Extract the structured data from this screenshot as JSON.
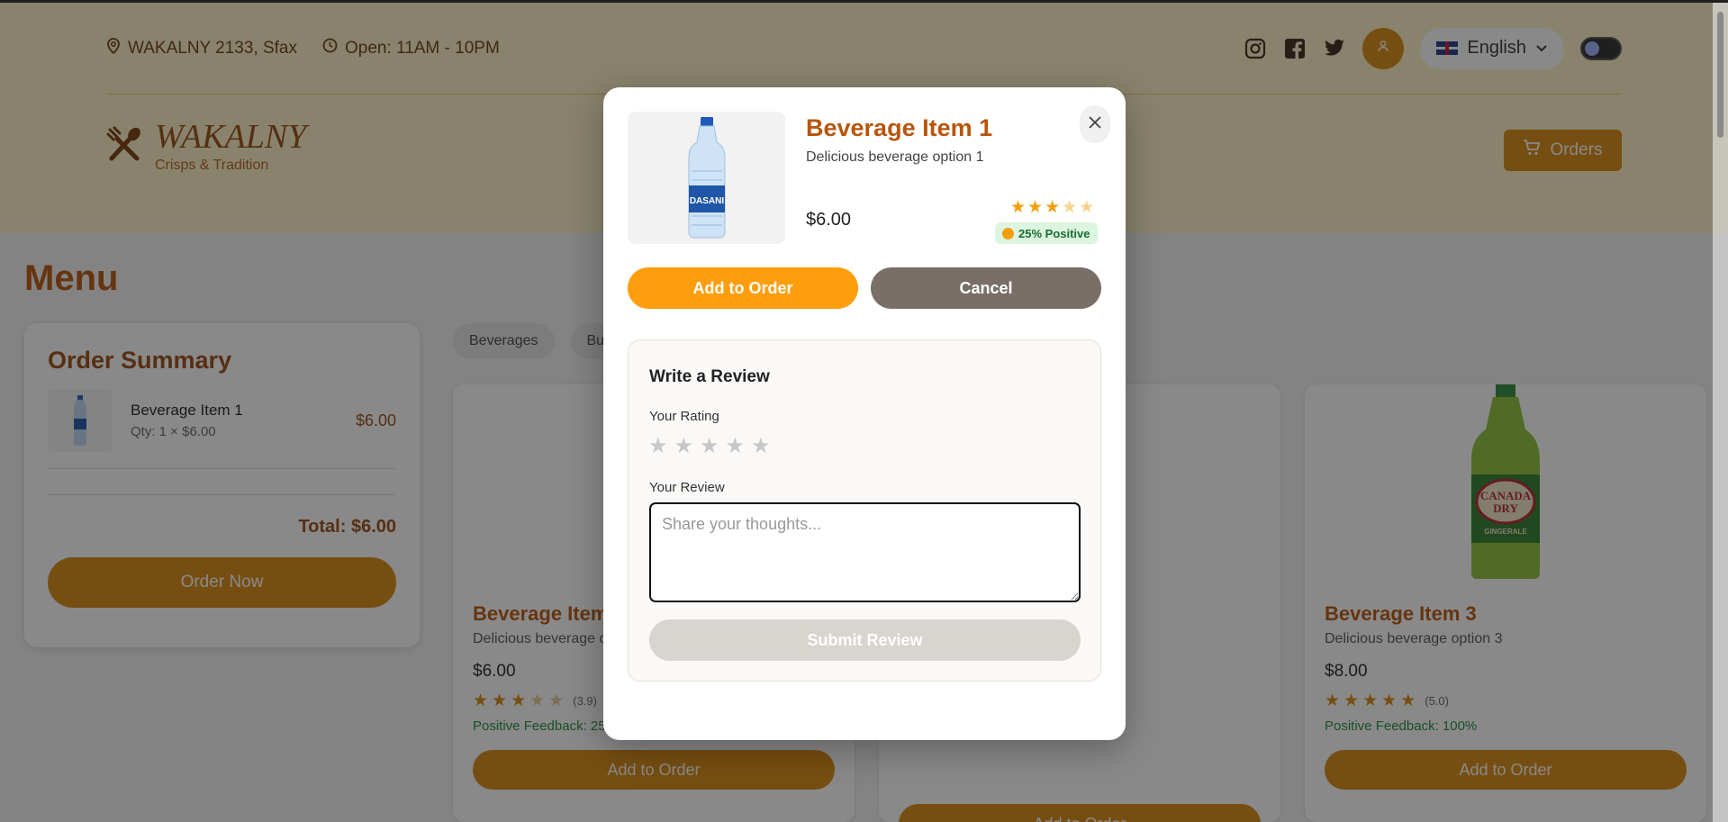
{
  "header": {
    "address": "WAKALNY 2133, Sfax",
    "hours": "Open: 11AM - 10PM",
    "language": "English",
    "brand_name": "WAKALNY",
    "brand_tagline": "Crisps & Tradition",
    "orders_label": "Orders"
  },
  "menu": {
    "title": "Menu",
    "categories": [
      "Beverages",
      "Bur"
    ]
  },
  "order_summary": {
    "title": "Order Summary",
    "item_name": "Beverage Item 1",
    "item_qty": "Qty: 1 × $6.00",
    "item_price": "$6.00",
    "total": "Total: $6.00",
    "order_now_label": "Order Now"
  },
  "cards": [
    {
      "title": "Beverage Item",
      "desc": "Delicious beverage o",
      "price": "$6.00",
      "rating_value": 3.9,
      "rating_text": "(3.9)",
      "feedback": "Positive Feedback: 25",
      "button": "Add to Order"
    },
    {
      "title": "",
      "desc": "",
      "price": "",
      "button": "Add to Order"
    },
    {
      "title": "Beverage Item 3",
      "desc": "Delicious beverage option 3",
      "price": "$8.00",
      "rating_value": 5.0,
      "rating_text": "(5.0)",
      "feedback": "Positive Feedback: 100%",
      "button": "Add to Order"
    }
  ],
  "modal": {
    "title": "Beverage Item 1",
    "description": "Delicious beverage option 1",
    "price": "$6.00",
    "rating_value": 3,
    "rating_max": 5,
    "positive_badge": "25% Positive",
    "add_label": "Add to Order",
    "cancel_label": "Cancel",
    "review": {
      "title": "Write a Review",
      "rating_label": "Your Rating",
      "review_label": "Your Review",
      "placeholder": "Share your thoughts...",
      "submit_label": "Submit Review"
    }
  },
  "colors": {
    "accent": "#d9890f",
    "modal_add": "#ff9e0d",
    "title": "#b8550c",
    "cancel": "#7a6f68",
    "positive": "#1f8a3b"
  },
  "icons": [
    "map-pin-icon",
    "clock-icon",
    "instagram-icon",
    "facebook-icon",
    "twitter-icon",
    "user-icon",
    "chevron-down-icon",
    "theme-toggle-icon",
    "utensils-icon",
    "cart-icon",
    "close-icon",
    "star-icon"
  ]
}
